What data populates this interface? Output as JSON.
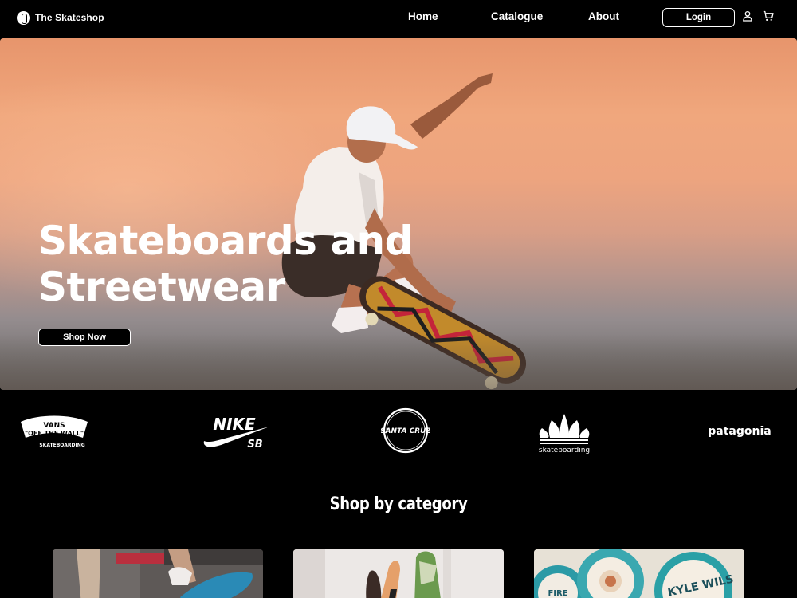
{
  "nav": {
    "brand_name": "The Skateshop",
    "links": [
      "Home",
      "Catalogue",
      "About"
    ],
    "login_label": "Login",
    "icons": [
      "user-icon",
      "cart-icon"
    ]
  },
  "hero": {
    "title_line1": "Skateboards and",
    "title_line2": "Streetwear",
    "cta_label": "Shop Now",
    "skater_shirt_text": "º"
  },
  "brands": {
    "vans_top": "VANS",
    "vans_main": "\"OFF THE WALL\"",
    "vans_sub": "SKATEBOARDING",
    "nike_main": "NIKE",
    "nike_sub": "SB",
    "santacruz": "SANTA CRUZ",
    "adidas_sub": "skateboarding",
    "patagonia": "patagonia"
  },
  "category": {
    "title": "Shop by category",
    "cards": [
      "skateboards-photo",
      "decks-photo",
      "wheels-photo"
    ],
    "wheel_text_1": "FIRE",
    "wheel_text_2": "KYLE WILS"
  },
  "colors": {
    "background": "#000000",
    "text": "#ffffff",
    "sky_top": "#e7956c",
    "sky_bottom": "#6b6765"
  }
}
